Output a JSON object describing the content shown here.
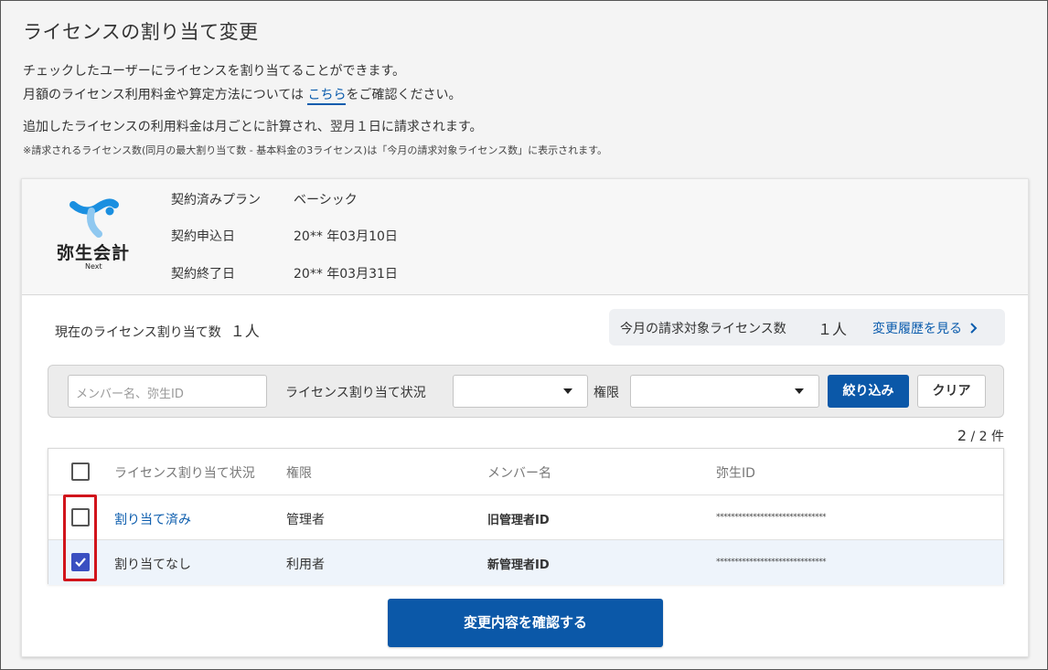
{
  "page": {
    "title": "ライセンスの割り当て変更",
    "desc1": "チェックしたユーザーにライセンスを割り当てることができます。",
    "desc2_pre": "月額のライセンス利用料金や算定方法については",
    "desc2_link": "こちら",
    "desc2_post": "をご確認ください。",
    "desc3": "追加したライセンスの利用料金は月ごとに計算され、翌月１日に請求されます。",
    "note": "※請求されるライセンス数(同月の最大割り当て数 - 基本料金の3ライセンス)は「今月の請求対象ライセンス数」に表示されます。"
  },
  "logo": {
    "name": "弥生会計",
    "sub": "Next",
    "colors": {
      "primary": "#1a8fe0",
      "light": "#8fc8f0"
    }
  },
  "plan": {
    "rows": [
      {
        "label": "契約済みプラン",
        "value": "ベーシック"
      },
      {
        "label": "契約申込日",
        "value": "20** 年03月10日"
      },
      {
        "label": "契約終了日",
        "value": "20** 年03月31日"
      }
    ]
  },
  "counts": {
    "current_label": "現在のライセンス割り当て数",
    "current_value": "１人",
    "billing_label": "今月の請求対象ライセンス数",
    "billing_value": "１人",
    "history_link": "変更履歴を見る"
  },
  "filter": {
    "search_placeholder": "メンバー名、弥生ID",
    "status_label": "ライセンス割り当て状況",
    "status_value": "",
    "role_label": "権限",
    "role_value": "",
    "apply_button": "絞り込み",
    "clear_button": "クリア"
  },
  "pagination": {
    "shown": "2",
    "total": "/ 2 件"
  },
  "table": {
    "headers": [
      "ライセンス割り当て状況",
      "権限",
      "メンバー名",
      "弥生ID"
    ],
    "rows": [
      {
        "checked": false,
        "status": "割り当て済み",
        "role": "管理者",
        "name": "旧管理者ID",
        "id": "******************************"
      },
      {
        "checked": true,
        "status": "割り当てなし",
        "role": "利用者",
        "name": "新管理者ID",
        "id": "******************************"
      }
    ]
  },
  "confirm_button": "変更内容を確認する",
  "colors": {
    "accent": "#0b58a8",
    "link": "#0b5cad",
    "checkbox": "#3a4fc1",
    "highlight": "#d1141b"
  }
}
